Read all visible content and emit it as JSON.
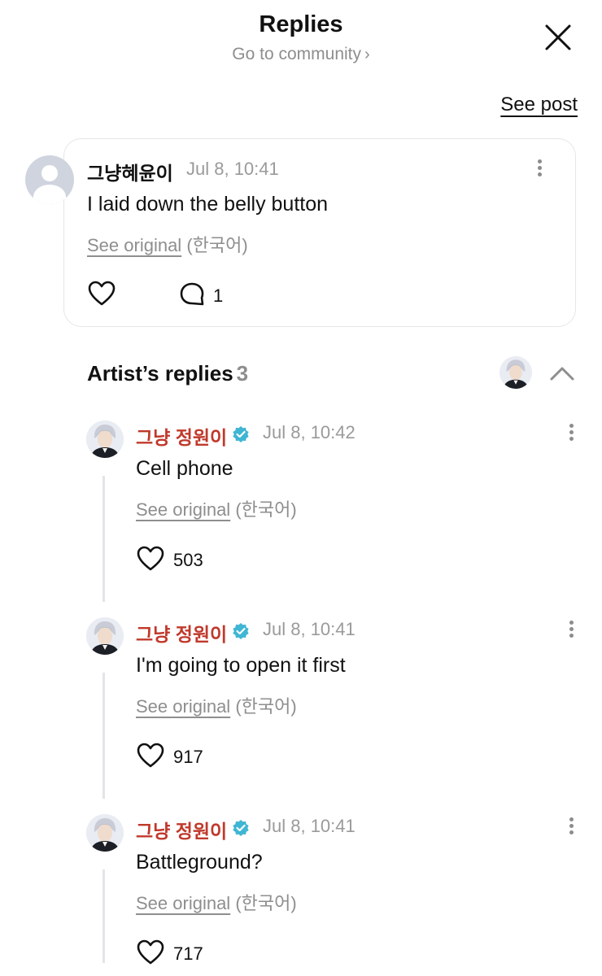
{
  "header": {
    "title": "Replies",
    "subtitle": "Go to community",
    "subtitle_chevron": "›",
    "see_post": "See post"
  },
  "post": {
    "author": "그냥혜윤이",
    "time": "Jul 8, 10:41",
    "text": "I laid down the belly button",
    "see_original": "See original",
    "language": "(한국어)",
    "comment_count": "1"
  },
  "artist_replies": {
    "title": "Artist’s replies",
    "count": "3",
    "replies": [
      {
        "author": "그냥 정원이",
        "time": "Jul 8, 10:42",
        "text": "Cell phone",
        "see_original": "See original",
        "language": "(한국어)",
        "likes": "503"
      },
      {
        "author": "그냥 정원이",
        "time": "Jul 8, 10:41",
        "text": "I'm going to open it first",
        "see_original": "See original",
        "language": "(한국어)",
        "likes": "917"
      },
      {
        "author": "그냥 정원이",
        "time": "Jul 8, 10:41",
        "text": "Battleground?",
        "see_original": "See original",
        "language": "(한국어)",
        "likes": "717"
      }
    ]
  },
  "colors": {
    "artist_name": "#c0392b",
    "verified_badge": "#3fb6d3",
    "muted_text": "#8e8e8e"
  },
  "icons": [
    "close-icon",
    "more-icon",
    "heart-icon",
    "comment-icon",
    "verified-icon",
    "chevron-up-icon",
    "default-avatar-icon"
  ]
}
